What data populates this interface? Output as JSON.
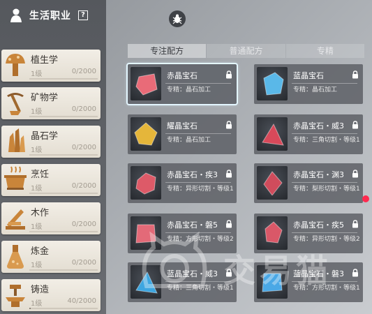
{
  "panel": {
    "title": "生活职业",
    "help": "?"
  },
  "skills": [
    {
      "name": "植生学",
      "level": "1级",
      "exp": "0/2000",
      "progress": 0
    },
    {
      "name": "矿物学",
      "level": "1级",
      "exp": "0/2000",
      "progress": 0
    },
    {
      "name": "晶石学",
      "level": "1级",
      "exp": "0/2000",
      "progress": 0
    },
    {
      "name": "烹饪",
      "level": "1级",
      "exp": "0/2000",
      "progress": 0
    },
    {
      "name": "木作",
      "level": "1级",
      "exp": "0/2000",
      "progress": 0
    },
    {
      "name": "炼金",
      "level": "1级",
      "exp": "0/2000",
      "progress": 0
    },
    {
      "name": "铸造",
      "level": "1级",
      "exp": "40/2000",
      "progress": 0.02
    }
  ],
  "tabs": [
    "专注配方",
    "普通配方",
    "专精"
  ],
  "recipes": [
    {
      "name": "赤晶宝石",
      "desc": "专精：晶石加工",
      "color": "#e96b78"
    },
    {
      "name": "蓝晶宝石",
      "desc": "专精：晶石加工",
      "color": "#5ab8e8"
    },
    {
      "name": "耀晶宝石",
      "desc": "专精：晶石加工",
      "color": "#e5b63a"
    },
    {
      "name": "赤晶宝石・威3",
      "desc": "专精：三角切割・等级1",
      "color": "#d8495a"
    },
    {
      "name": "赤晶宝石・疾3",
      "desc": "专精：异形切割・等级1",
      "color": "#dd5a68"
    },
    {
      "name": "赤晶宝石・渊3",
      "desc": "专精：梨形切割・等级1",
      "color": "#d04c5c"
    },
    {
      "name": "赤晶宝石・磐5",
      "desc": "专精：方形切割・等级2",
      "color": "#e36a78"
    },
    {
      "name": "赤晶宝石・疾5",
      "desc": "专精：异形切割・等级2",
      "color": "#d95868"
    },
    {
      "name": "蓝晶宝石・威3",
      "desc": "专精：三角切割・等级1",
      "color": "#3da6e0"
    },
    {
      "name": "蓝晶宝石・磐3",
      "desc": "专精：方形切割・等级1",
      "color": "#4aa8e6"
    }
  ],
  "watermark": "交易猫",
  "colors": {
    "accent_selected": "#e4f6ff",
    "notify_dot": "#ff2a4f"
  }
}
